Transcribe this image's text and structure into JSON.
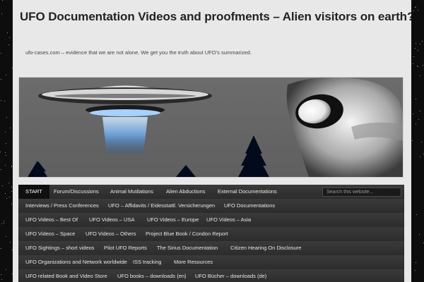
{
  "site": {
    "title": "UFO Documentation Videos and proofments – Alien visitors on earth?",
    "description": "ufo-cases.com – evidence that we are not alone. We get you the truth about UFO’s summarized."
  },
  "search": {
    "placeholder": "Search this website..."
  },
  "nav": {
    "rows": [
      [
        "START",
        "Forum/Discussions",
        "Animal Mutilations",
        "Alien Abductions",
        "External Documentations"
      ],
      [
        "Interviews / Press Conferences",
        "UFO – Affidavits / Eidesstattl. Versicherungen",
        "UFO Documentations"
      ],
      [
        "UFO Videos – Best Of",
        "UFO Videos – USA",
        "UFO Videos – Europe",
        "UFO Videos – Asia"
      ],
      [
        "UFO Videos – Space",
        "UFO Videos – Others",
        "Project Blue Book / Condon Report"
      ],
      [
        "UFO Sightings – short videos",
        "Pilot UFO Reports",
        "The Sirius Documentation",
        "Citizen Hearing On Disclosure"
      ],
      [
        "UFO Organizations and Network worldwide",
        "ISS tracking",
        "More Resources"
      ],
      [
        "UFO related Book and Video Store",
        "UFO books – downloads (en)",
        "UFO Bücher – downloads (de)"
      ]
    ],
    "active": "START"
  },
  "colors": {
    "page_bg": "#e8e8e8",
    "body_bg": "#0d0d0d",
    "nav_bg": "#2c2c2c",
    "nav_active": "#101010",
    "title": "#222222"
  }
}
